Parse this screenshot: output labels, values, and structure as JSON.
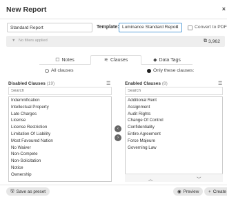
{
  "dialog": {
    "title": "New Report"
  },
  "report": {
    "name_value": "Standard Report",
    "template_label": "Template:",
    "template_value": "Luminance Standard Report",
    "pdf_label": "Convert to PDF"
  },
  "filters": {
    "text": "No filters applied",
    "count": "3,962"
  },
  "tabs": [
    {
      "label": "Notes",
      "active": false
    },
    {
      "label": "Clauses",
      "active": true
    },
    {
      "label": "Data Tags",
      "active": false
    }
  ],
  "clause_mode": {
    "all_label": "All clauses",
    "only_label": "Only these clauses:",
    "selected": "only"
  },
  "disabled": {
    "title": "Disabled Clauses",
    "count": "(19)",
    "search_placeholder": "Search",
    "items": [
      "Indemnification",
      "Intellectual Property",
      "Late Charges",
      "License",
      "License Restriction",
      "Limitation Of Liability",
      "Most Favoured Nation",
      "No Waiver",
      "Non-Compete",
      "Non-Solicitation",
      "Notice",
      "Ownership"
    ]
  },
  "enabled": {
    "title": "Enabled Clauses",
    "count": "(8)",
    "search_placeholder": "Search",
    "items": [
      "Additional Rent",
      "Assignment",
      "Audit Rights",
      "Change Of Control",
      "Confidentiality",
      "Entire Agreement",
      "Force Majeure",
      "Governing Law"
    ]
  },
  "buttons": {
    "save_preset": "Save as preset",
    "preview": "Preview",
    "create": "Create"
  }
}
